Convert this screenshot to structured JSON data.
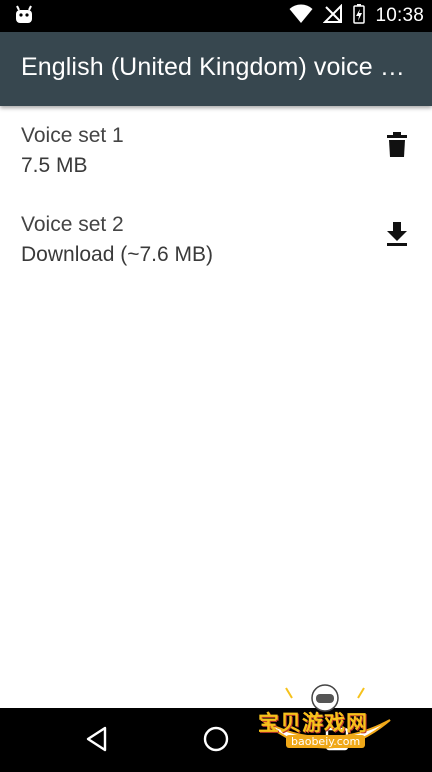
{
  "status_bar": {
    "time": "10:38",
    "icons": [
      "android-debug-icon",
      "wifi-icon",
      "no-signal-icon",
      "battery-charging-icon"
    ]
  },
  "app_bar": {
    "title": "English (United Kingdom) voice sets",
    "background": "#37474f"
  },
  "voice_sets": [
    {
      "name": "Voice set 1",
      "detail": "7.5 MB",
      "action_icon": "delete-icon"
    },
    {
      "name": "Voice set 2",
      "detail": "Download (~7.6 MB)",
      "action_icon": "download-icon"
    }
  ],
  "nav_bar": {
    "icons": [
      "back-icon",
      "home-icon",
      "recents-icon"
    ]
  },
  "watermark": {
    "text": "宝贝游戏网",
    "domain": "baobeiy.com"
  }
}
